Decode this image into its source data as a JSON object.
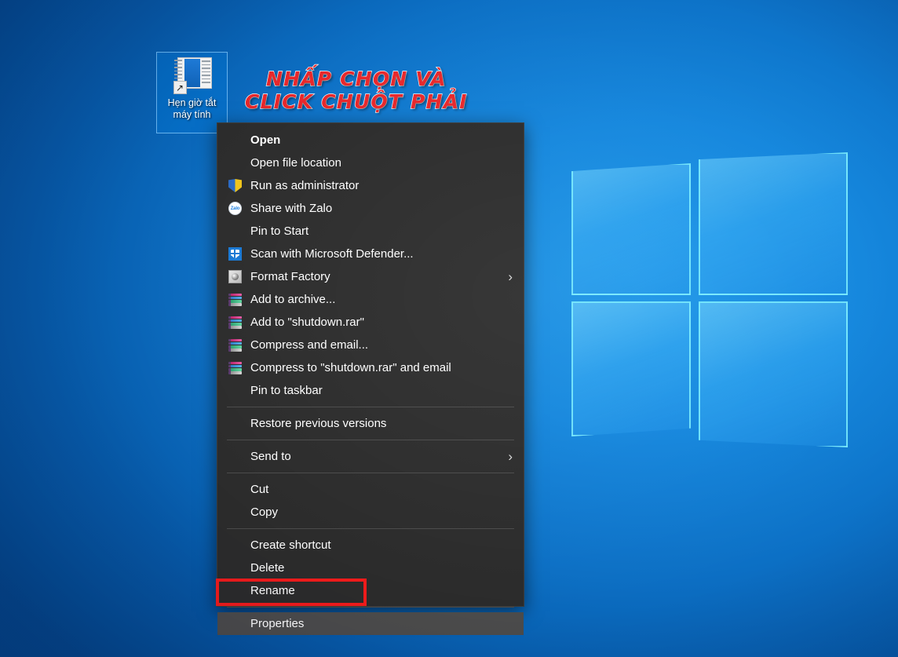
{
  "desktop": {
    "icon": {
      "label": "Hẹn giờ tắt\nmáy tính",
      "glyph_shortcut": "↗"
    },
    "annotation": {
      "line1": "NHẤP CHỌN VÀ",
      "line2": "CLICK CHUỘT PHẢI",
      "color": "#e8262a",
      "outline_color": "#ffffff"
    },
    "wallpaper": {
      "name": "windows-10-logo",
      "accent": "#1386dd"
    }
  },
  "context_menu": {
    "background": "#2b2b2b",
    "selected_background": "#4b4b4b",
    "highlight_box_color": "#ef1b1b",
    "selected_item": "Properties",
    "groups": [
      {
        "items": [
          {
            "label": "Open",
            "icon": "",
            "bold": true,
            "submenu": false
          },
          {
            "label": "Open file location",
            "icon": "",
            "bold": false,
            "submenu": false
          },
          {
            "label": "Run as administrator",
            "icon": "uac-shield-icon",
            "bold": false,
            "submenu": false
          },
          {
            "label": "Share with Zalo",
            "icon": "zalo-icon",
            "bold": false,
            "submenu": false
          },
          {
            "label": "Pin to Start",
            "icon": "",
            "bold": false,
            "submenu": false
          },
          {
            "label": "Scan with Microsoft Defender...",
            "icon": "defender-shield-icon",
            "bold": false,
            "submenu": false
          },
          {
            "label": "Format Factory",
            "icon": "format-factory-icon",
            "bold": false,
            "submenu": true
          },
          {
            "label": "Add to archive...",
            "icon": "winrar-icon",
            "bold": false,
            "submenu": false
          },
          {
            "label": "Add to \"shutdown.rar\"",
            "icon": "winrar-icon",
            "bold": false,
            "submenu": false
          },
          {
            "label": "Compress and email...",
            "icon": "winrar-icon",
            "bold": false,
            "submenu": false
          },
          {
            "label": "Compress to \"shutdown.rar\" and email",
            "icon": "winrar-icon",
            "bold": false,
            "submenu": false
          },
          {
            "label": "Pin to taskbar",
            "icon": "",
            "bold": false,
            "submenu": false
          }
        ]
      },
      {
        "items": [
          {
            "label": "Restore previous versions",
            "icon": "",
            "bold": false,
            "submenu": false
          }
        ]
      },
      {
        "items": [
          {
            "label": "Send to",
            "icon": "",
            "bold": false,
            "submenu": true
          }
        ]
      },
      {
        "items": [
          {
            "label": "Cut",
            "icon": "",
            "bold": false,
            "submenu": false
          },
          {
            "label": "Copy",
            "icon": "",
            "bold": false,
            "submenu": false
          }
        ]
      },
      {
        "items": [
          {
            "label": "Create shortcut",
            "icon": "",
            "bold": false,
            "submenu": false
          },
          {
            "label": "Delete",
            "icon": "",
            "bold": false,
            "submenu": false
          },
          {
            "label": "Rename",
            "icon": "",
            "bold": false,
            "submenu": false
          }
        ]
      },
      {
        "items": [
          {
            "label": "Properties",
            "icon": "",
            "bold": false,
            "submenu": false,
            "selected": true
          }
        ]
      }
    ],
    "submenu_glyph": "›",
    "zalo_text": "Zalo"
  }
}
